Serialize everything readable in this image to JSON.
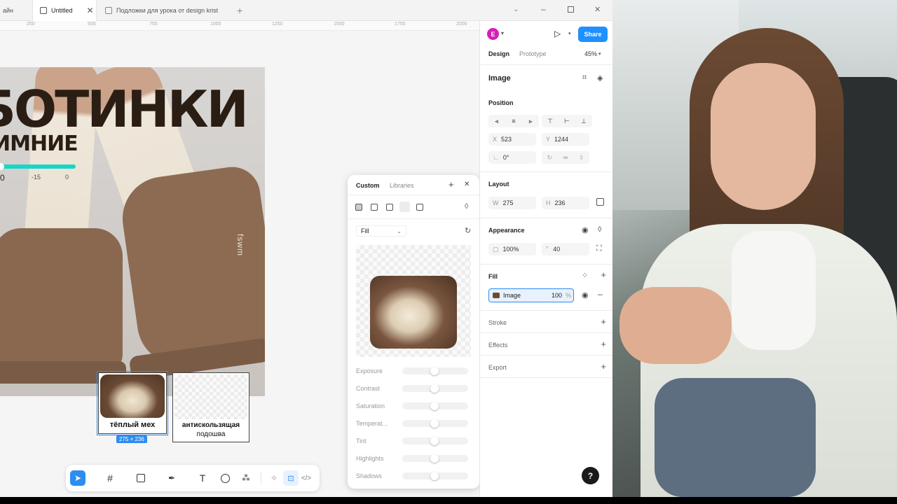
{
  "tabs": [
    {
      "label": "айн",
      "active": false
    },
    {
      "label": "Untitled",
      "active": true
    },
    {
      "label": "Подложки для урока от design krist",
      "active": false
    }
  ],
  "ruler_ticks": [
    "250",
    "500",
    "750",
    "1000",
    "1250",
    "1500",
    "1750",
    "2000"
  ],
  "canvas": {
    "headline": "БОТИНКИ",
    "subheadline": "ИМНИЕ",
    "temp_labels": [
      "0",
      "-15",
      "0"
    ],
    "card1_label": "тёплый мех",
    "card2_label_line1": "антискользящая",
    "card2_label_line2": "подошва",
    "size_badge": "275 × 236",
    "shoe_brand": "fswm"
  },
  "toolbar": {
    "tools": [
      "move-tool",
      "frame-tool",
      "image-tool",
      "pen-tool",
      "text-tool",
      "comment-tool",
      "components-tool",
      "actions-tool",
      "dev-tool",
      "code-tool"
    ]
  },
  "fill_picker": {
    "tab_custom": "Custom",
    "tab_libraries": "Libraries",
    "fill_mode": "Fill",
    "adjustments": [
      "Exposure",
      "Contrast",
      "Saturation",
      "Temperat...",
      "Tint",
      "Highlights",
      "Shadows"
    ]
  },
  "right_panel": {
    "avatar_letter": "E",
    "share_label": "Share",
    "tab_design": "Design",
    "tab_prototype": "Prototype",
    "zoom": "45%",
    "layer_type": "Image",
    "position_title": "Position",
    "x_label": "X",
    "x_value": "523",
    "y_label": "Y",
    "y_value": "1244",
    "rotation_value": "0°",
    "layout_title": "Layout",
    "w_label": "W",
    "w_value": "275",
    "h_label": "H",
    "h_value": "236",
    "appearance_title": "Appearance",
    "opacity_value": "100%",
    "radius_value": "40",
    "fill_title": "Fill",
    "fill_type": "Image",
    "fill_opacity": "100",
    "fill_percent": "%",
    "stroke_title": "Stroke",
    "effects_title": "Effects",
    "export_title": "Export"
  },
  "help_label": "?"
}
